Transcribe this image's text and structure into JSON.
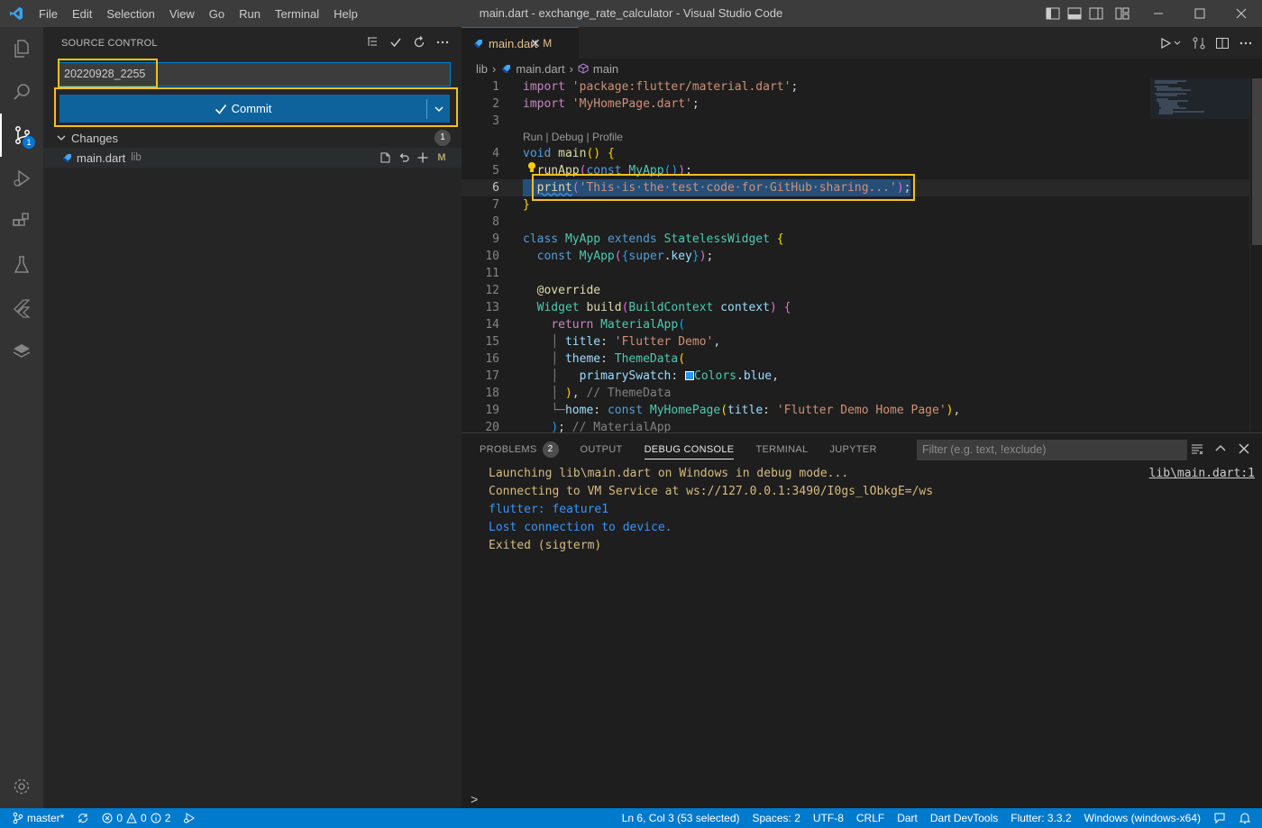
{
  "window": {
    "title": "main.dart - exchange_rate_calculator - Visual Studio Code",
    "menu": [
      "File",
      "Edit",
      "Selection",
      "View",
      "Go",
      "Run",
      "Terminal",
      "Help"
    ]
  },
  "activity_bar": {
    "items": [
      "explorer",
      "search",
      "source-control",
      "run-debug",
      "extensions",
      "testing",
      "flutter",
      "layers"
    ],
    "active": "source-control",
    "scm_badge": "1"
  },
  "sidebar": {
    "title": "SOURCE CONTROL",
    "commit_message": "20220928_2255",
    "commit_button": "Commit",
    "changes_label": "Changes",
    "changes_count": "1",
    "file": {
      "name": "main.dart",
      "dir": "lib",
      "status": "M"
    }
  },
  "editor": {
    "tab": {
      "name": "main.dart",
      "status": "M"
    },
    "breadcrumb": [
      "lib",
      "main.dart",
      "main"
    ],
    "codelens": "Run | Debug | Profile",
    "line_numbers": [
      "1",
      "2",
      "3",
      "4",
      "5",
      "6",
      "7",
      "8",
      "9",
      "10",
      "11",
      "12",
      "13",
      "14",
      "15",
      "16",
      "17",
      "18",
      "19",
      "20"
    ],
    "current_line": "6"
  },
  "panel": {
    "tabs": [
      "PROBLEMS",
      "OUTPUT",
      "DEBUG CONSOLE",
      "TERMINAL",
      "JUPYTER"
    ],
    "active_tab": "DEBUG CONSOLE",
    "problems_count": "2",
    "filter_placeholder": "Filter (e.g. text, !exclude)",
    "source_link": "lib\\main.dart:1",
    "console_lines": [
      "Launching lib\\main.dart on Windows in debug mode...",
      "Connecting to VM Service at ws://127.0.0.1:3490/I0gs_lObkgE=/ws",
      "flutter: feature1",
      "Lost connection to device.",
      "Exited (sigterm)"
    ],
    "prompt": ">"
  },
  "status_bar": {
    "branch": "master*",
    "errors": "0",
    "warnings": "0",
    "infos": "2",
    "position": "Ln 6, Col 3 (53 selected)",
    "spaces": "Spaces: 2",
    "encoding": "UTF-8",
    "eol": "CRLF",
    "language": "Dart",
    "devtools": "Dart DevTools",
    "flutter": "Flutter: 3.3.2",
    "device": "Windows (windows-x64)"
  },
  "colors": {
    "accent": "#007acc",
    "highlight": "#f2c01e",
    "commit_button": "#0e639c"
  }
}
